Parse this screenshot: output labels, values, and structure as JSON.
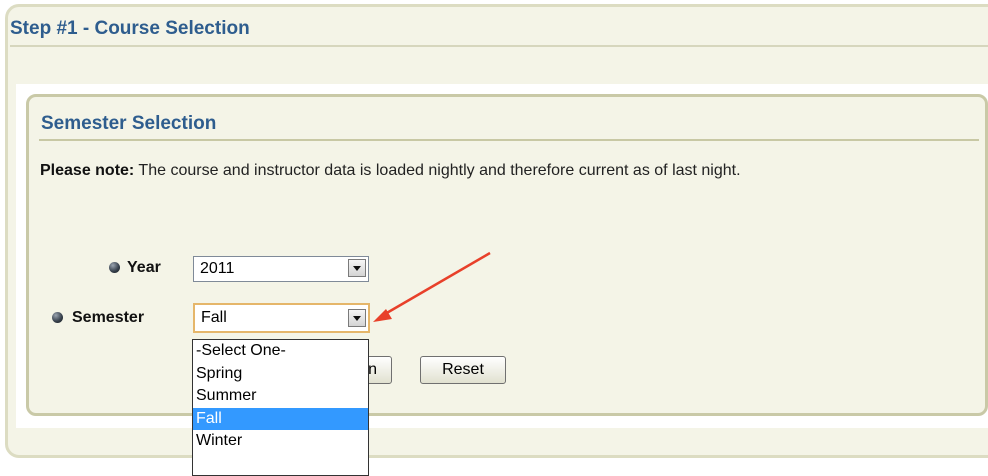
{
  "step": {
    "title": "Step #1 - Course Selection"
  },
  "semester_section": {
    "title": "Semester Selection",
    "note_bold": "Please note:",
    "note_text": " The course and instructor data is loaded nightly and therefore current as of last night."
  },
  "form": {
    "year_label": "Year",
    "year_value": "2011",
    "semester_label": "Semester",
    "semester_value": "Fall",
    "semester_options": [
      "-Select One-",
      "Spring",
      "Summer",
      "Fall",
      "Winter"
    ],
    "semester_selected_index": 3,
    "hidden_button_partial": "n",
    "reset_label": "Reset"
  },
  "colors": {
    "heading": "#2e5d8e",
    "panel_bg": "#f4f4e7",
    "highlight": "#3399ff",
    "annotation_arrow": "#e8402a"
  },
  "icons": {
    "bullet": "sphere-bullet-icon",
    "dropdown": "chevron-down-icon",
    "annotation": "red-arrow-annotation"
  }
}
